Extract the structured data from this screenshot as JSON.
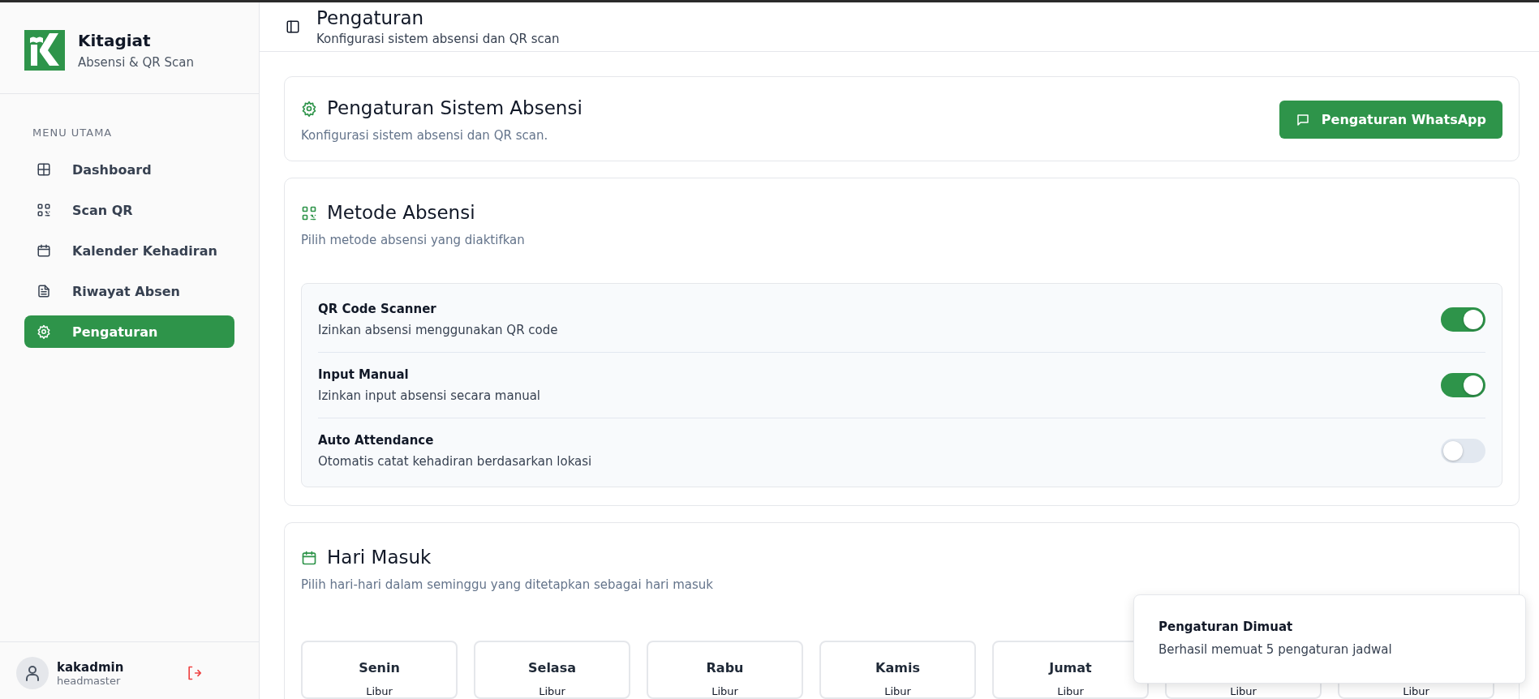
{
  "brand": {
    "name": "Kitagiat",
    "tagline": "Absensi & QR Scan"
  },
  "sidebar": {
    "section_label": "MENU UTAMA",
    "items": [
      {
        "label": "Dashboard",
        "selected": false
      },
      {
        "label": "Scan QR",
        "selected": false
      },
      {
        "label": "Kalender Kehadiran",
        "selected": false
      },
      {
        "label": "Riwayat Absen",
        "selected": false
      },
      {
        "label": "Pengaturan",
        "selected": true
      }
    ]
  },
  "user": {
    "name": "kakadmin",
    "role": "headmaster"
  },
  "header": {
    "title": "Pengaturan",
    "subtitle": "Konfigurasi sistem absensi dan QR scan"
  },
  "settings_card": {
    "title": "Pengaturan Sistem Absensi",
    "subtitle": "Konfigurasi sistem absensi dan QR scan.",
    "button": "Pengaturan WhatsApp"
  },
  "methods_card": {
    "title": "Metode Absensi",
    "subtitle": "Pilih metode absensi yang diaktifkan",
    "options": [
      {
        "label": "QR Code Scanner",
        "description": "Izinkan absensi menggunakan QR code",
        "on": true
      },
      {
        "label": "Input Manual",
        "description": "Izinkan input absensi secara manual",
        "on": true
      },
      {
        "label": "Auto Attendance",
        "description": "Otomatis catat kehadiran berdasarkan lokasi",
        "on": false
      }
    ]
  },
  "days_card": {
    "title": "Hari Masuk",
    "subtitle": "Pilih hari-hari dalam seminggu yang ditetapkan sebagai hari masuk",
    "days": [
      {
        "name": "Senin",
        "status": "Libur"
      },
      {
        "name": "Selasa",
        "status": "Libur"
      },
      {
        "name": "Rabu",
        "status": "Libur"
      },
      {
        "name": "Kamis",
        "status": "Libur"
      },
      {
        "name": "Jumat",
        "status": "Libur"
      },
      {
        "status": "Libur"
      },
      {
        "status": "Libur"
      }
    ]
  },
  "toast": {
    "title": "Pengaturan Dimuat",
    "message": "Berhasil memuat 5 pengaturan jadwal"
  }
}
